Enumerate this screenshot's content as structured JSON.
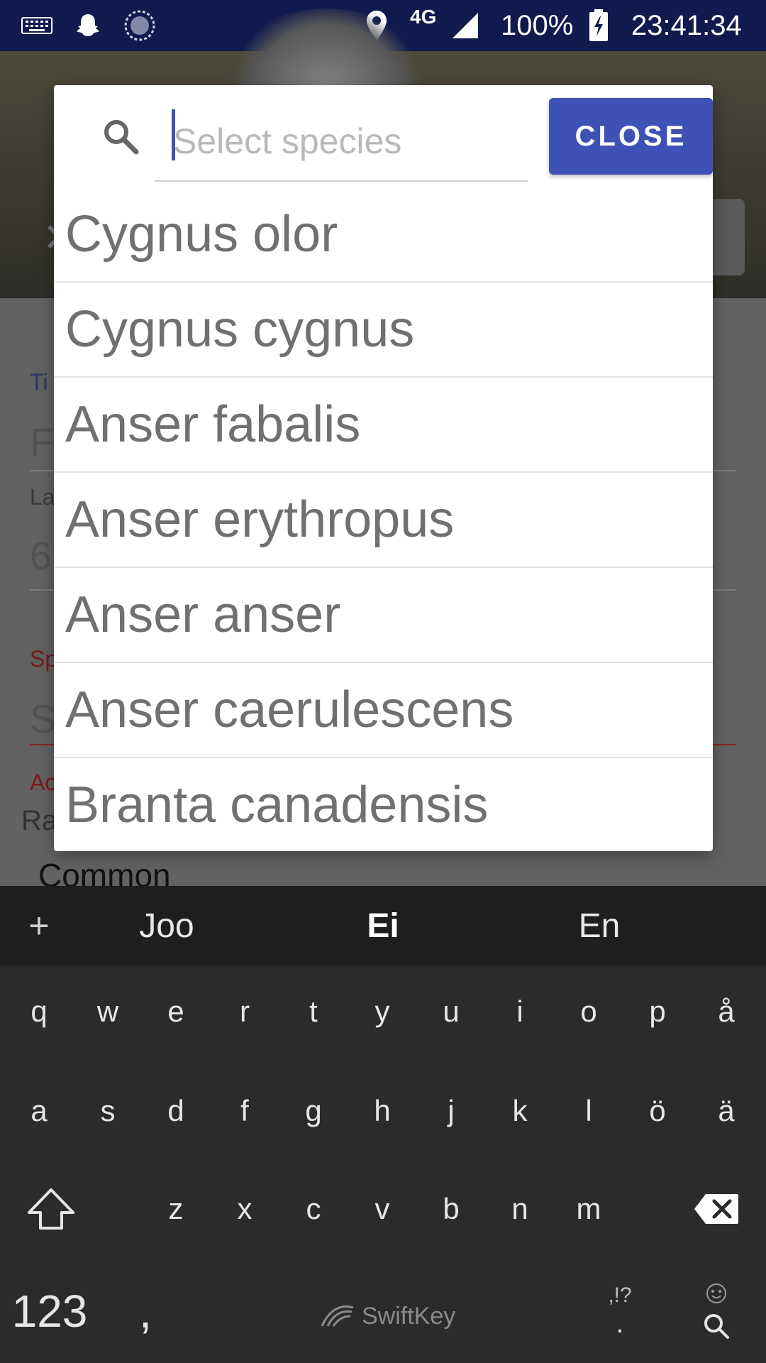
{
  "status_bar": {
    "network": "4G",
    "battery": "100%",
    "time": "23:41:34",
    "icons": [
      "keyboard-icon",
      "snapchat-icon",
      "sync-icon",
      "location-icon",
      "signal-icon",
      "battery-charging-icon"
    ]
  },
  "dialog": {
    "search_placeholder": "Select species",
    "search_value": "",
    "close_label": "CLOSE",
    "species": [
      "Cygnus olor",
      "Cygnus cygnus",
      "Anser fabalis",
      "Anser erythropus",
      "Anser anser",
      "Anser caerulescens",
      "Branta canadensis"
    ]
  },
  "background_form": {
    "label_1": "Ti",
    "value_1": "F",
    "label_2": "La",
    "value_2": "6",
    "label_3": "Sp",
    "value_3": "S",
    "label_4": "Ac",
    "value_4": "Ra",
    "value_5": "Common"
  },
  "keyboard": {
    "suggestions": [
      "Joo",
      "Ei",
      "En"
    ],
    "row1": [
      "q",
      "w",
      "e",
      "r",
      "t",
      "y",
      "u",
      "i",
      "o",
      "p",
      "å"
    ],
    "row2": [
      "a",
      "s",
      "d",
      "f",
      "g",
      "h",
      "j",
      "k",
      "l",
      "ö",
      "ä"
    ],
    "row3": [
      "z",
      "x",
      "c",
      "v",
      "b",
      "n",
      "m"
    ],
    "numbers_key": "123",
    "comma_key": ",",
    "punct_key_top": ",!?",
    "punct_key_bottom": ".",
    "brand": "SwiftKey"
  }
}
